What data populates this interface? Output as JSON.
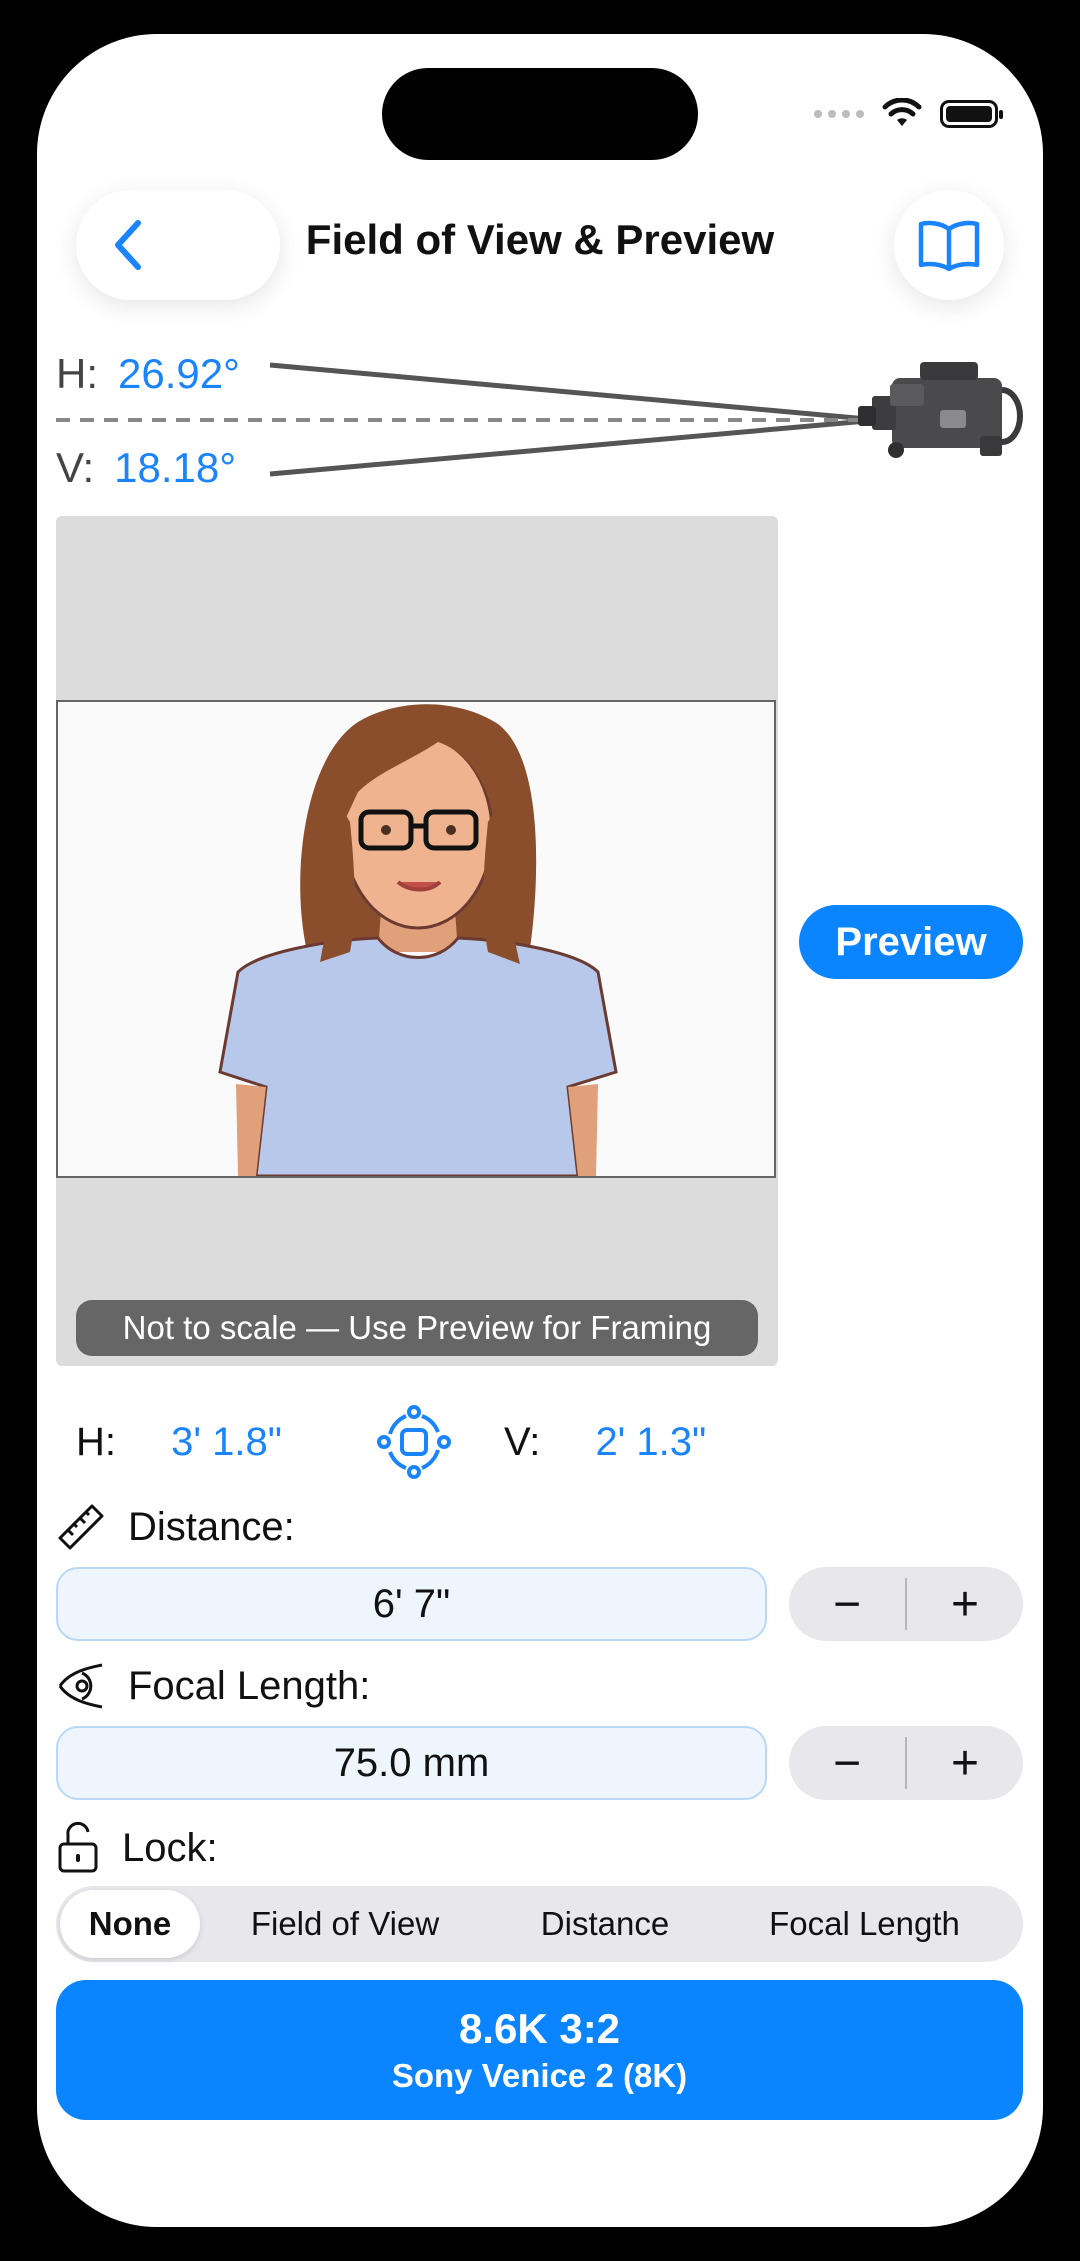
{
  "header": {
    "title": "Field of View & Preview"
  },
  "angles": {
    "h_label": "H:",
    "h_value": "26.92°",
    "v_label": "V:",
    "v_value": "18.18°"
  },
  "frame": {
    "note": "Not to scale — Use Preview for Framing"
  },
  "preview_button": "Preview",
  "dimensions": {
    "h_label": "H:",
    "h_value": "3' 1.8\"",
    "v_label": "V:",
    "v_value": "2' 1.3\""
  },
  "distance": {
    "label": "Distance:",
    "value": "6' 7\"",
    "minus": "−",
    "plus": "+"
  },
  "focal_length": {
    "label": "Focal Length:",
    "value": "75.0 mm",
    "minus": "−",
    "plus": "+"
  },
  "lock": {
    "label": "Lock:",
    "options": [
      "None",
      "Field of View",
      "Distance",
      "Focal Length"
    ],
    "selected": "None"
  },
  "camera": {
    "format": "8.6K 3:2",
    "model": "Sony Venice 2 (8K)"
  },
  "colors": {
    "accent": "#0a84ff",
    "value_text": "#1a84ff"
  },
  "icons": [
    "chevron-left-icon",
    "book-icon",
    "video-camera-icon",
    "swap-orientation-icon",
    "ruler-icon",
    "eye-icon",
    "lock-open-icon",
    "wifi-icon",
    "battery-icon"
  ]
}
